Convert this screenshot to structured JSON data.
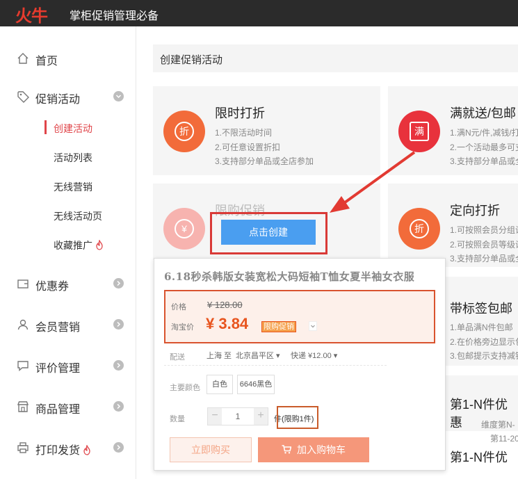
{
  "app": {
    "logo_text": "火牛",
    "title": "掌柜促销管理必备"
  },
  "sidebar": {
    "items": [
      {
        "label": "首页",
        "icon": "home-icon"
      },
      {
        "label": "促销活动",
        "icon": "tag-icon",
        "expanded": true
      },
      {
        "label": "优惠券",
        "icon": "wallet-icon"
      },
      {
        "label": "会员营销",
        "icon": "user-icon"
      },
      {
        "label": "评价管理",
        "icon": "comment-icon"
      },
      {
        "label": "商品管理",
        "icon": "shop-icon"
      },
      {
        "label": "打印发货",
        "icon": "printer-icon",
        "hot": true
      }
    ],
    "sub_items": [
      {
        "label": "创建活动",
        "active": true
      },
      {
        "label": "活动列表"
      },
      {
        "label": "无线营销"
      },
      {
        "label": "无线活动页"
      },
      {
        "label": "收藏推广",
        "hot": true
      }
    ]
  },
  "main": {
    "header": "创建促销活动",
    "create_button": "点击创建",
    "cards": [
      {
        "title": "限时打折",
        "icon_char": "折",
        "color": "#f26b3a",
        "lines": [
          "1.不限活动时间",
          "2.可任意设置折扣",
          "3.支持部分单品或全店参加"
        ]
      },
      {
        "title": "满就送/包邮",
        "icon_char": "满",
        "color": "#e8323c",
        "lines": [
          "1.满N元/件,减钱/打",
          "2.一个活动最多可支",
          "3.支持部分单品或全"
        ]
      },
      {
        "title": "限购促销",
        "icon_char": "¥",
        "color": "#f7a7a2",
        "lines": []
      },
      {
        "title": "定向打折",
        "icon_char": "折",
        "color": "#f26b3a",
        "lines": [
          "1.可按照会员分组设",
          "2.可按照会员等级设",
          "3.支持部分单品或全"
        ]
      },
      {
        "title": "带标签包邮",
        "lines": [
          "1.单品满N件包邮",
          "2.在价格旁边显示包",
          "3.包邮提示支持减钱"
        ]
      },
      {
        "title": "第1-N件优惠",
        "lines": [
          "维度第N-",
          "第11-20"
        ]
      },
      {
        "title": "第1-N件优",
        "lines": []
      }
    ]
  },
  "product": {
    "title": "6.18秒杀韩版女装宽松大码短袖T恤女夏半袖女衣服",
    "price_label": "价格",
    "original_price": "¥ 128.00",
    "taobao_label": "淘宝价",
    "price": "¥ 3.84",
    "promo_badge": "限购促销",
    "shipping_label": "配送",
    "ship_from": "上海 至",
    "ship_to": "北京昌平区",
    "express": "快递 ¥12.00",
    "color_label": "主要颜色",
    "colors": [
      "白色",
      "6646黑色"
    ],
    "qty_label": "数量",
    "qty_minus": "−",
    "qty_value": "1",
    "qty_plus": "+",
    "limit_text": "件(限购1件)",
    "buy_now": "立即购买",
    "add_cart": "加入购物车"
  },
  "colors": {
    "accent_red": "#d93a37",
    "primary_blue": "#4a9ef0",
    "price_orange": "#e8541e"
  }
}
